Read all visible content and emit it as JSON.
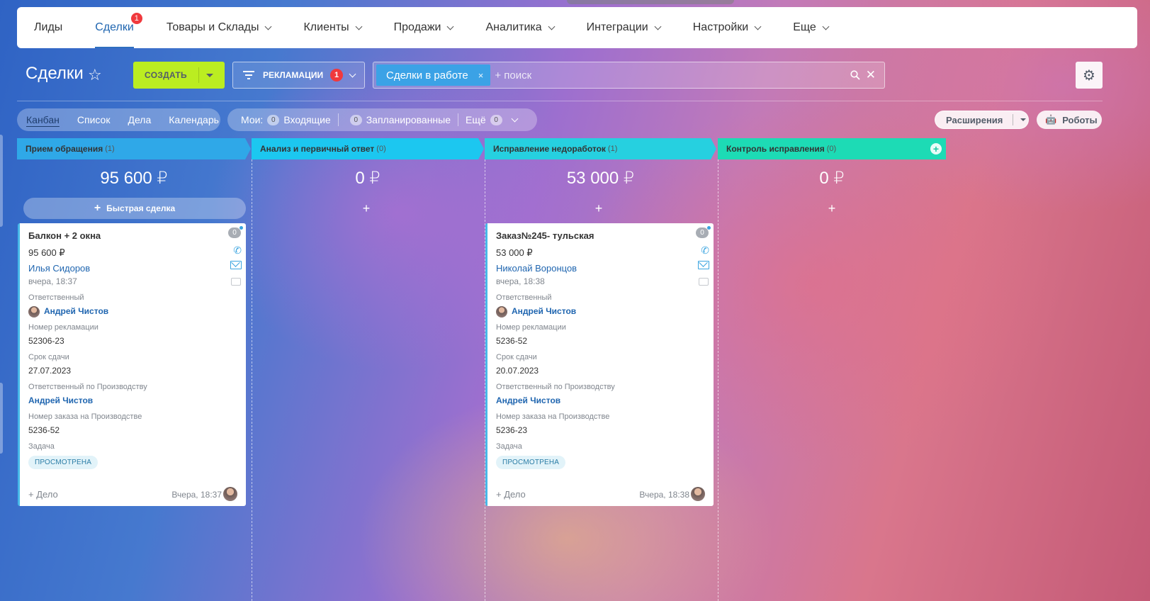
{
  "nav": {
    "items": [
      {
        "label": "Лиды",
        "has_menu": false
      },
      {
        "label": "Сделки",
        "badge": "1",
        "active": true
      },
      {
        "label": "Товары и Склады",
        "has_menu": true
      },
      {
        "label": "Клиенты",
        "has_menu": true
      },
      {
        "label": "Продажи",
        "has_menu": true
      },
      {
        "label": "Аналитика",
        "has_menu": true
      },
      {
        "label": "Интеграции",
        "has_menu": true
      },
      {
        "label": "Настройки",
        "has_menu": true
      },
      {
        "label": "Еще",
        "has_menu": true
      }
    ]
  },
  "toolbar": {
    "title": "Сделки",
    "create_label": "СОЗДАТЬ",
    "category_label": "РЕКЛАМАЦИИ",
    "category_badge": "1",
    "filter_tag": "Сделки в работе",
    "filter_remove": "×",
    "search_placeholder": "+ поиск"
  },
  "views": [
    "Канбан",
    "Список",
    "Дела",
    "Календарь"
  ],
  "counters": {
    "label": "Мои:",
    "incoming_count": "0",
    "incoming_label": "Входящие",
    "planned_count": "0",
    "planned_label": "Запланированные",
    "more_label": "Ещё",
    "more_count": "0"
  },
  "extensions_label": "Расширения",
  "robots_label": "Роботы",
  "quick_deal_label": "Быстрая сделка",
  "stages": [
    {
      "name": "Прием обращения",
      "count": "(1)",
      "sum": "95 600 ₽",
      "color": "#2fa8e8"
    },
    {
      "name": "Анализ и первичный ответ",
      "count": "(0)",
      "sum": "0 ₽",
      "color": "#1cc7f0"
    },
    {
      "name": "Исправление недоработок",
      "count": "(1)",
      "sum": "53 000 ₽",
      "color": "#26d0e0"
    },
    {
      "name": "Контроль исправления",
      "count": "(0)",
      "sum": "0 ₽",
      "color": "#1ddbb5"
    }
  ],
  "cards": [
    {
      "title": "Балкон + 2 окна",
      "price": "95 600 ₽",
      "client": "Илья Сидоров",
      "date": "вчера, 18:37",
      "counter": "0",
      "responsible_label": "Ответственный",
      "responsible": "Андрей Чистов",
      "claim_label": "Номер рекламации",
      "claim": "52306-23",
      "deadline_label": "Срок сдачи",
      "deadline": "27.07.2023",
      "prod_resp_label": "Ответственный по Производству",
      "prod_resp": "Андрей Чистов",
      "prod_order_label": "Номер заказа на Производстве",
      "prod_order": "5236-52",
      "task_label": "Задача",
      "task_status": "ПРОСМОТРЕНА",
      "add_activity": "+ Дело",
      "footer_date": "Вчера, 18:37"
    },
    {
      "title": "Заказ№245- тульская",
      "price": "53 000 ₽",
      "client": "Николай Воронцов",
      "date": "вчера, 18:38",
      "counter": "0",
      "responsible_label": "Ответственный",
      "responsible": "Андрей Чистов",
      "claim_label": "Номер рекламации",
      "claim": "5236-52",
      "deadline_label": "Срок сдачи",
      "deadline": "20.07.2023",
      "prod_resp_label": "Ответственный по Производству",
      "prod_resp": "Андрей Чистов",
      "prod_order_label": "Номер заказа на Производстве",
      "prod_order": "5236-23",
      "task_label": "Задача",
      "task_status": "ПРОСМОТРЕНА",
      "add_activity": "+ Дело",
      "footer_date": "Вчера, 18:38"
    }
  ]
}
